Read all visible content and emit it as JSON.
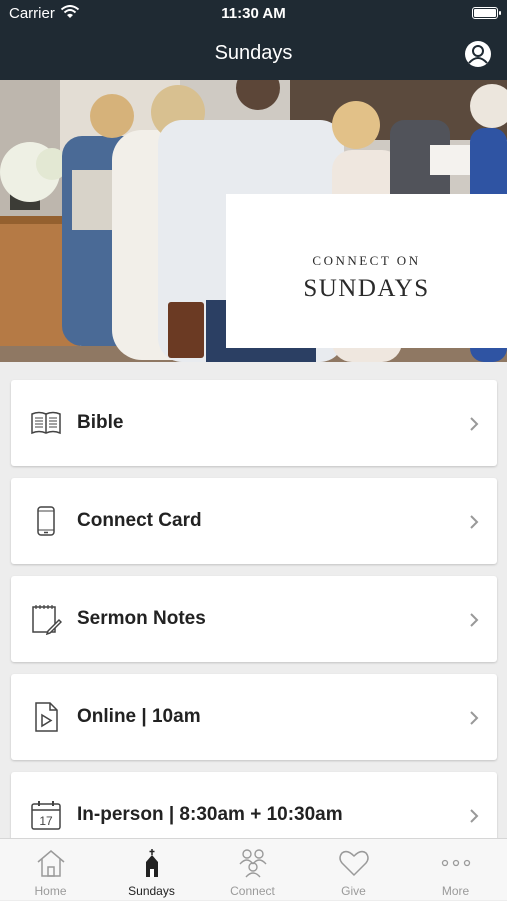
{
  "status_bar": {
    "carrier": "Carrier",
    "time": "11:30 AM",
    "battery_level": 1.0
  },
  "nav": {
    "title": "Sundays"
  },
  "hero": {
    "line1": "CONNECT ON",
    "line2": "SUNDAYS"
  },
  "menu": [
    {
      "label": "Bible",
      "icon": "book-icon"
    },
    {
      "label": "Connect Card",
      "icon": "phone-icon"
    },
    {
      "label": "Sermon Notes",
      "icon": "notepad-pencil-icon"
    },
    {
      "label": "Online |  10am",
      "icon": "video-file-icon"
    },
    {
      "label": "In-person | 8:30am + 10:30am",
      "icon": "calendar-icon"
    }
  ],
  "calendar_day": "17",
  "tabs": [
    {
      "label": "Home",
      "icon": "home-icon"
    },
    {
      "label": "Sundays",
      "icon": "chapel-icon",
      "active": true
    },
    {
      "label": "Connect",
      "icon": "people-icon"
    },
    {
      "label": "Give",
      "icon": "heart-icon"
    },
    {
      "label": "More",
      "icon": "more-dots-icon"
    }
  ],
  "colors": {
    "header_bg": "#1f2a33",
    "active_tab": "#222222",
    "inactive_tab": "#9a9a9a"
  }
}
